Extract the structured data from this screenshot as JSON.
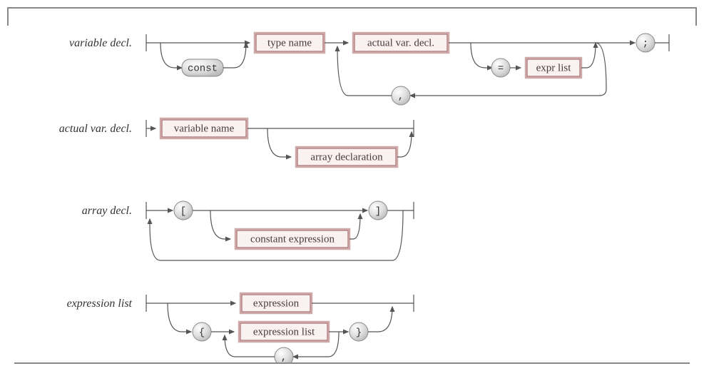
{
  "rules": {
    "variable_decl": {
      "label": "variable decl.",
      "nodes": {
        "type_name": "type name",
        "actual_var_decl": "actual var. decl.",
        "expr_list": "expr list"
      },
      "terms": {
        "const": "const",
        "equals": "=",
        "comma": ",",
        "semicolon": ";"
      }
    },
    "actual_var_decl": {
      "label": "actual var. decl.",
      "nodes": {
        "variable_name": "variable name",
        "array_declaration": "array declaration"
      }
    },
    "array_decl": {
      "label": "array decl.",
      "nodes": {
        "constant_expression": "constant expression"
      },
      "terms": {
        "lbracket": "[",
        "rbracket": "]"
      }
    },
    "expression_list": {
      "label": "expression list",
      "nodes": {
        "expression": "expression",
        "expression_list": "expression list"
      },
      "terms": {
        "lbrace": "{",
        "rbrace": "}",
        "comma": ","
      }
    }
  }
}
